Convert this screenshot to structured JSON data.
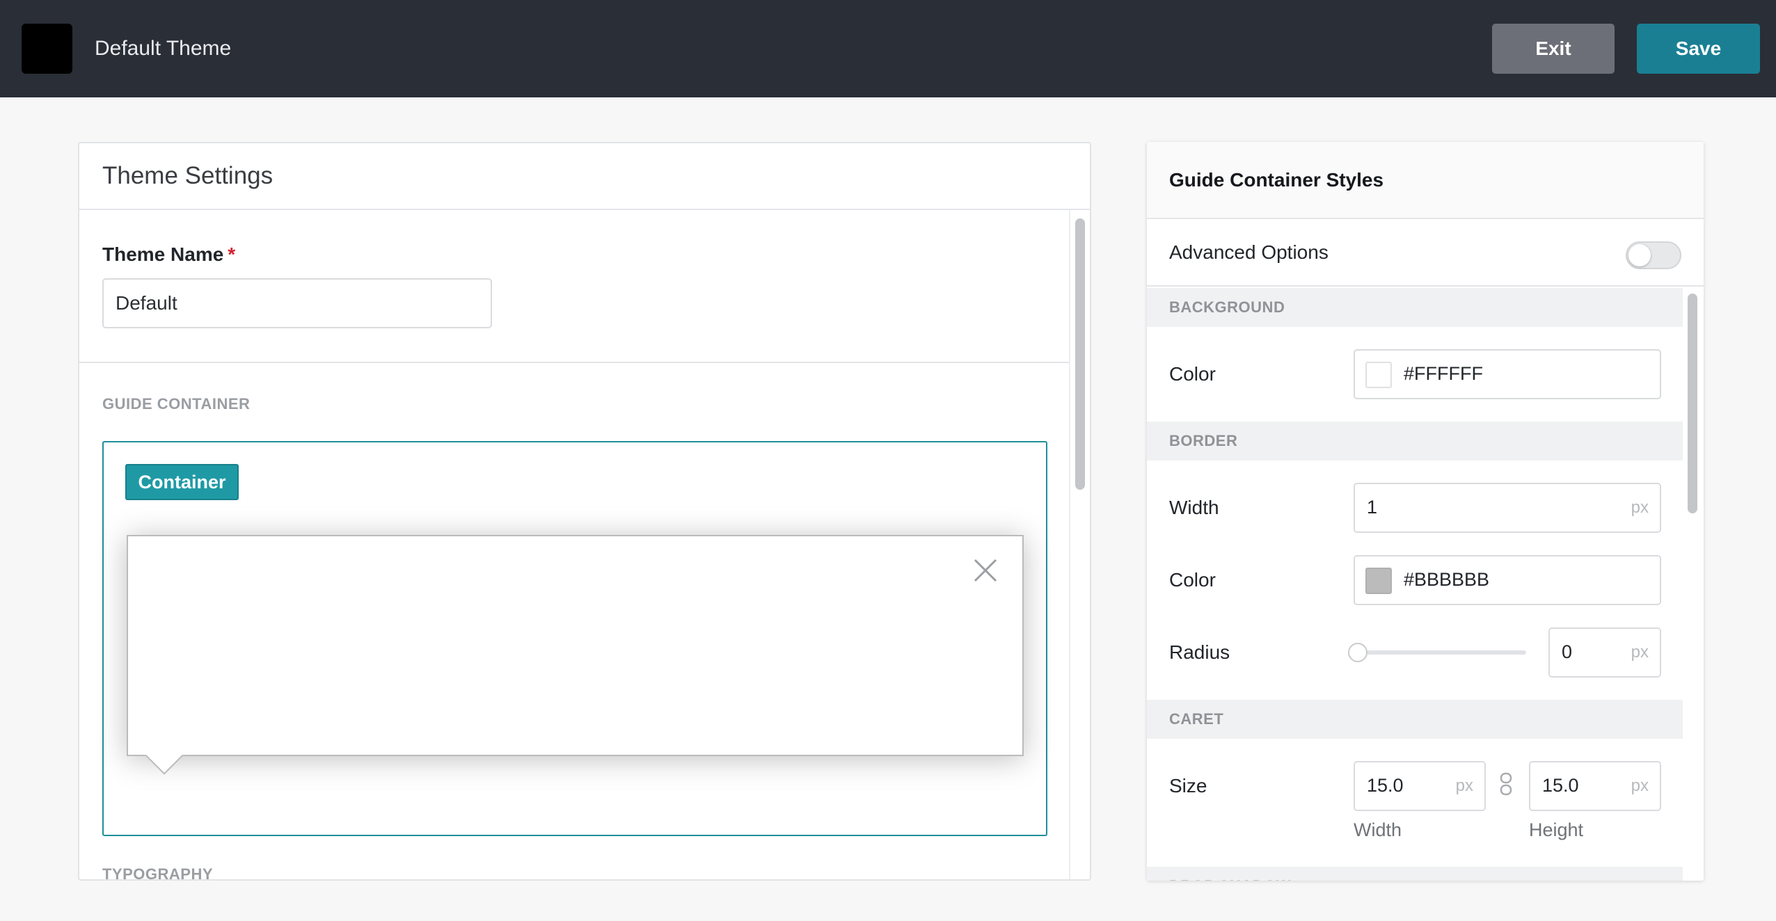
{
  "header": {
    "title": "Default Theme",
    "exit_label": "Exit",
    "save_label": "Save"
  },
  "theme_settings": {
    "title": "Theme Settings",
    "theme_name_label": "Theme Name",
    "required_mark": "*",
    "theme_name_value": "Default",
    "guide_container_section": "GUIDE CONTAINER",
    "container_tag": "Container",
    "typography_section": "TYPOGRAPHY"
  },
  "styles_panel": {
    "title": "Guide Container Styles",
    "advanced_options_label": "Advanced Options",
    "advanced_options_on": false,
    "background": {
      "heading": "BACKGROUND",
      "color_label": "Color",
      "color_value": "#FFFFFF"
    },
    "border": {
      "heading": "BORDER",
      "width_label": "Width",
      "width_value": "1",
      "unit": "px",
      "color_label": "Color",
      "color_value": "#BBBBBB",
      "radius_label": "Radius",
      "radius_value": "0",
      "radius_slider_value": 0
    },
    "caret": {
      "heading": "CARET",
      "size_label": "Size",
      "width_value": "15.0",
      "height_value": "15.0",
      "unit": "px",
      "width_caption": "Width",
      "height_caption": "Height"
    },
    "drop_shadow": {
      "heading": "DROP SHADOW"
    }
  },
  "colors": {
    "topbar": "#2a2e37",
    "save_button": "#1a7f93",
    "exit_button": "#6c6f77",
    "accent": "#1f9aa5"
  }
}
